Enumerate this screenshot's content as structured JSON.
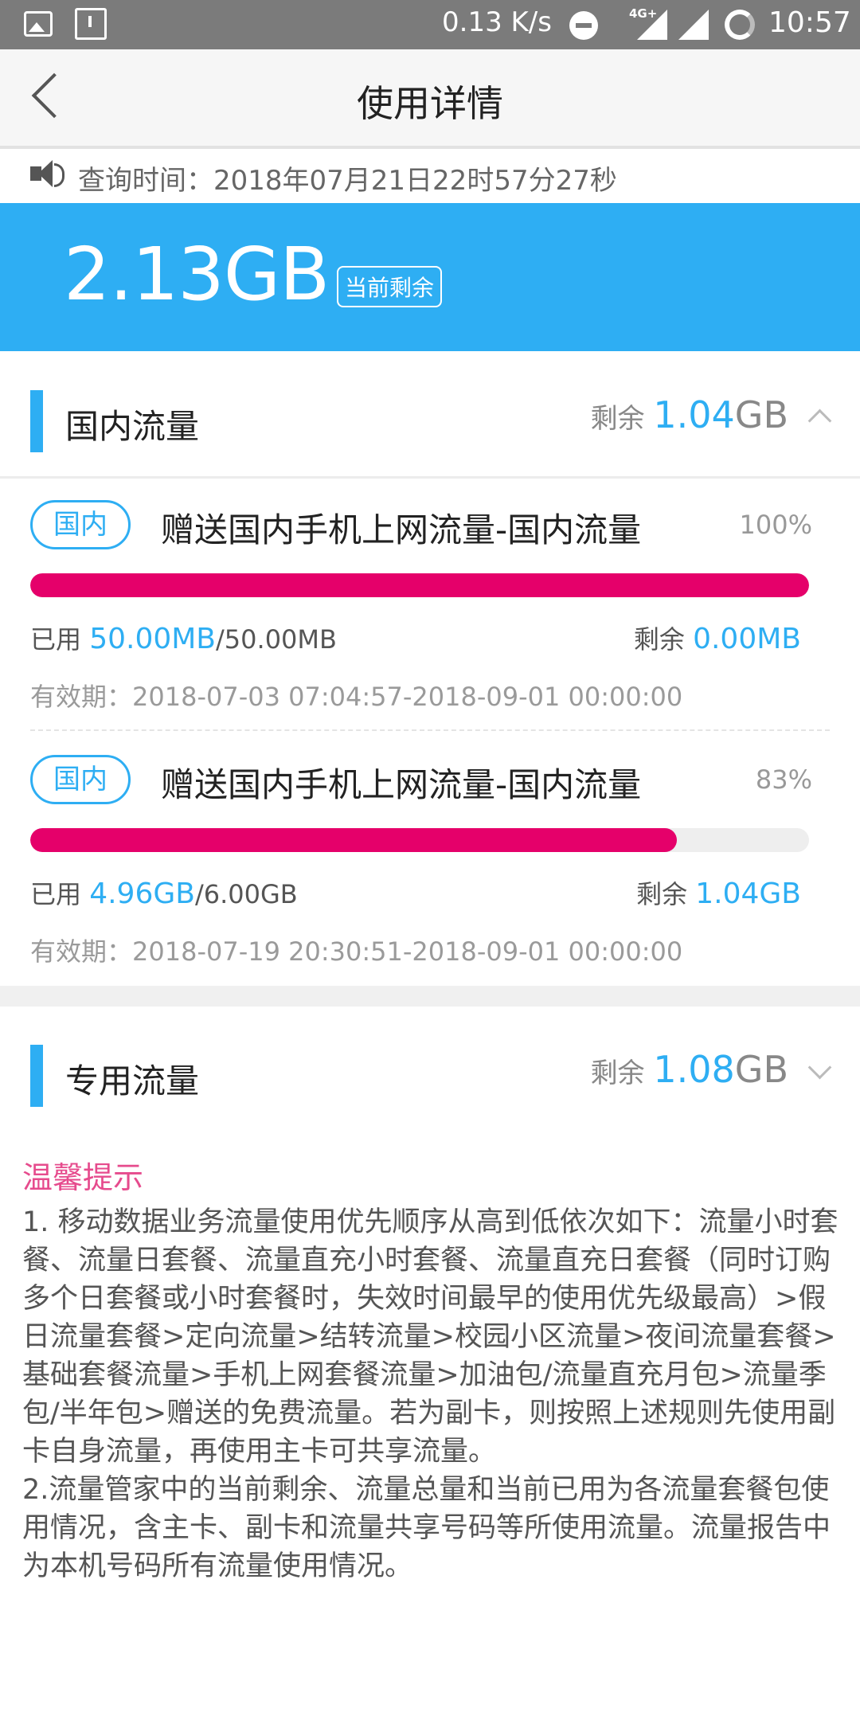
{
  "status_bar": {
    "speed": "0.13 K/s",
    "network": "4G+",
    "time": "10:57"
  },
  "header": {
    "title": "使用详情"
  },
  "query": {
    "text": "查询时间：2018年07月21日22时57分27秒"
  },
  "summary": {
    "value": "2.13GB",
    "tag": "当前剩余"
  },
  "domestic": {
    "title": "国内流量",
    "remain_label": "剩余",
    "remain_num": "1.04",
    "remain_unit": "GB",
    "items": [
      {
        "badge": "国内",
        "title": "赠送国内手机上网流量-国内流量",
        "percent": "100%",
        "progress": 1.0,
        "used_label": "已用",
        "used": "50.00MB",
        "total": "/50.00MB",
        "remain_label": "剩余",
        "remain": "0.00MB",
        "validity": "有效期：2018-07-03 07:04:57-2018-09-01 00:00:00"
      },
      {
        "badge": "国内",
        "title": "赠送国内手机上网流量-国内流量",
        "percent": "83%",
        "progress": 0.83,
        "used_label": "已用",
        "used": "4.96GB",
        "total": "/6.00GB",
        "remain_label": "剩余",
        "remain": "1.04GB",
        "validity": "有效期：2018-07-19 20:30:51-2018-09-01 00:00:00"
      }
    ]
  },
  "special": {
    "title": "专用流量",
    "remain_label": "剩余",
    "remain_num": "1.08",
    "remain_unit": "GB"
  },
  "tips": {
    "title": "温馨提示",
    "p1": "1. 移动数据业务流量使用优先顺序从高到低依次如下：流量小时套餐、流量日套餐、流量直充小时套餐、流量直充日套餐（同时订购多个日套餐或小时套餐时，失效时间最早的使用优先级最高）>假日流量套餐>定向流量>结转流量>校园小区流量>夜间流量套餐>基础套餐流量>手机上网套餐流量>加油包/流量直充月包>流量季包/半年包>赠送的免费流量。若为副卡，则按照上述规则先使用副卡自身流量，再使用主卡可共享流量。",
    "p2": "2.流量管家中的当前剩余、流量总量和当前已用为各流量套餐包使用情况，含主卡、副卡和流量共享号码等所使用流量。流量报告中为本机号码所有流量使用情况。"
  }
}
